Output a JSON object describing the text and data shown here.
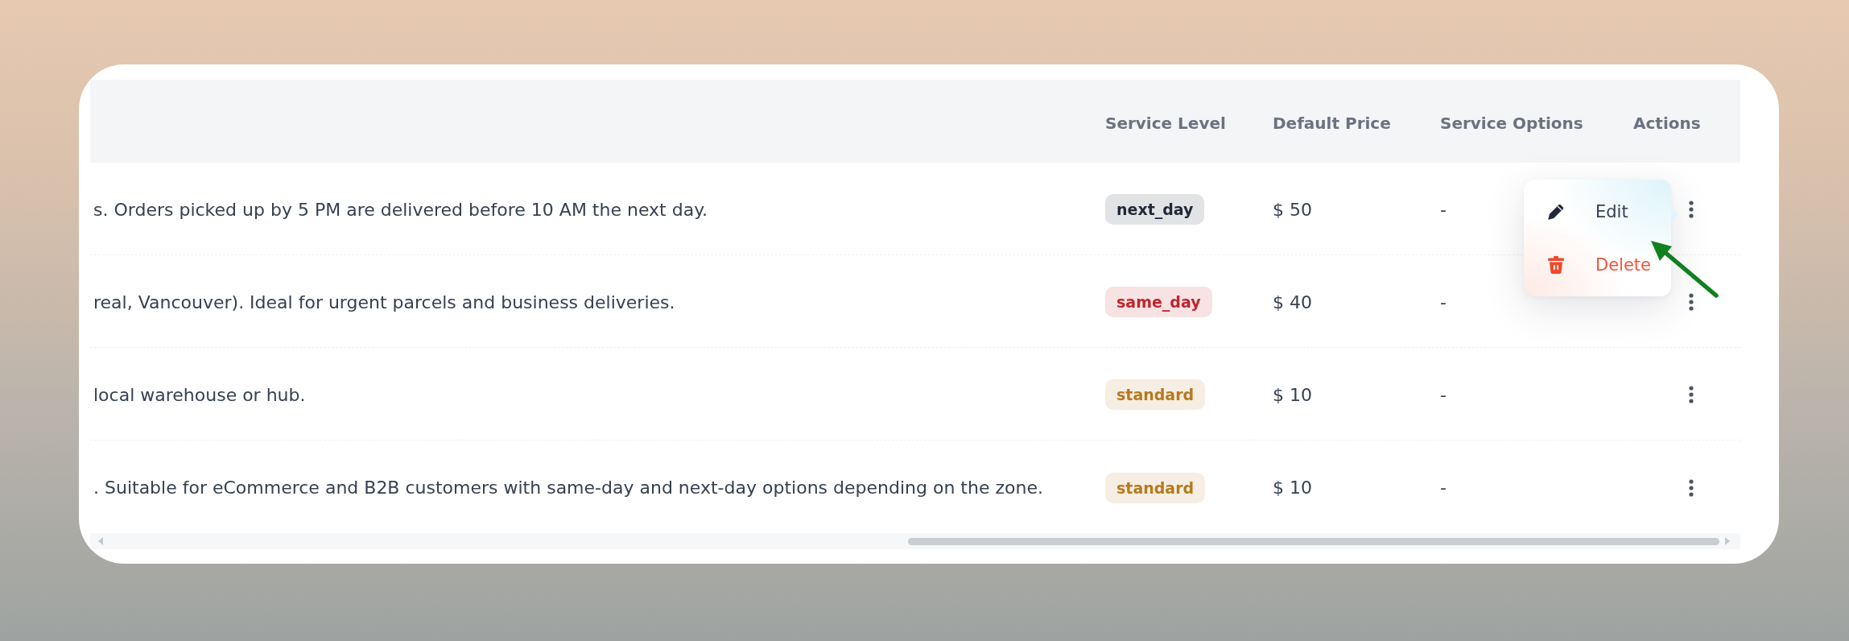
{
  "table": {
    "columns": [
      "Service Level",
      "Default Price",
      "Service Options",
      "Actions"
    ],
    "rows": [
      {
        "column_1": "s. Orders picked up by 5 PM are delivered before 10 AM the next day.",
        "service_level": {
          "label": "next_day",
          "color": "#1f2937"
        },
        "default_price": "$ 50",
        "service_options": "-",
        "menu_open": true
      },
      {
        "column_1": "real, Vancouver). Ideal for urgent parcels and business deliveries.",
        "service_level": {
          "label": "same_day",
          "color": "#c0262d"
        },
        "default_price": "$ 40",
        "service_options": "-",
        "menu_open": false
      },
      {
        "column_1": "local warehouse or hub.",
        "service_level": {
          "label": "standard",
          "color": "#b7791f"
        },
        "default_price": "$ 10",
        "service_options": "-",
        "menu_open": false
      },
      {
        "column_1": ". Suitable for eCommerce and B2B customers with same-day and next-day options depending on the zone.",
        "service_level": {
          "label": "standard",
          "color": "#b7791f"
        },
        "default_price": "$ 10",
        "service_options": "-",
        "menu_open": false
      }
    ],
    "row_menu": {
      "items": [
        {
          "label": "Edit",
          "kind": "edit"
        },
        {
          "label": "Delete",
          "kind": "delete"
        }
      ]
    }
  }
}
